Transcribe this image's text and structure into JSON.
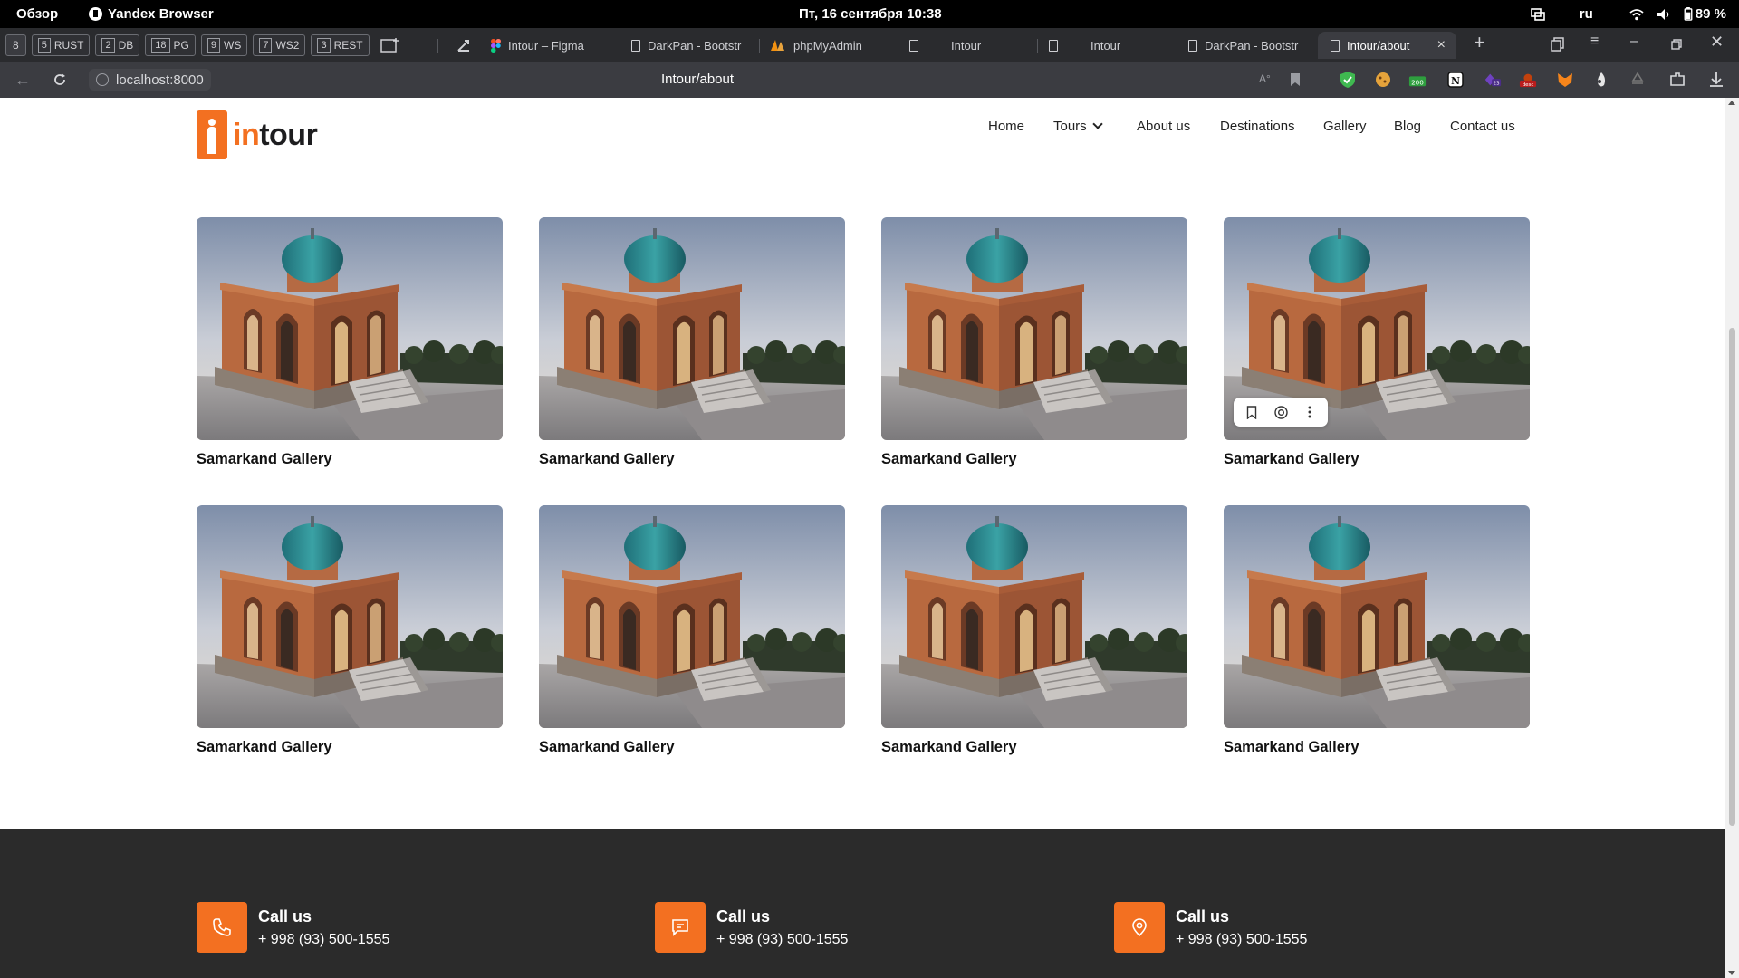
{
  "os_bar": {
    "overview": "Обзор",
    "app_name": "Yandex Browser",
    "clock": "Пт, 16 сентября  10:38",
    "lang": "ru",
    "battery": "89 %"
  },
  "workspaces": [
    {
      "num": "8",
      "label": ""
    },
    {
      "num": "5",
      "label": "RUST"
    },
    {
      "num": "2",
      "label": "DB"
    },
    {
      "num": "18",
      "label": "PG"
    },
    {
      "num": "9",
      "label": "WS"
    },
    {
      "num": "7",
      "label": "WS2"
    },
    {
      "num": "3",
      "label": "REST"
    }
  ],
  "tabs": [
    {
      "label": "Intour – Figma"
    },
    {
      "label": "DarkPan - Bootstr"
    },
    {
      "label": "phpMyAdmin"
    },
    {
      "label": "Intour"
    },
    {
      "label": "Intour"
    },
    {
      "label": "DarkPan - Bootstr"
    },
    {
      "label": "Intour/about"
    }
  ],
  "address_bar": {
    "url": "localhost:8000",
    "page_title": "Intour/about"
  },
  "site": {
    "logo_in": "in",
    "logo_tour": "tour",
    "nav": [
      "Home",
      "Tours",
      "About us",
      "Destinations",
      "Gallery",
      "Blog",
      "Contact us"
    ]
  },
  "gallery": [
    {
      "caption": "Samarkand Gallery"
    },
    {
      "caption": "Samarkand Gallery"
    },
    {
      "caption": "Samarkand Gallery"
    },
    {
      "caption": "Samarkand Gallery"
    },
    {
      "caption": "Samarkand Gallery"
    },
    {
      "caption": "Samarkand Gallery"
    },
    {
      "caption": "Samarkand Gallery"
    },
    {
      "caption": "Samarkand Gallery"
    }
  ],
  "footer": {
    "contacts": [
      {
        "title": "Call us",
        "value": "+ 998 (93) 500-1555",
        "icon": "phone-icon"
      },
      {
        "title": "Call us",
        "value": "+ 998 (93) 500-1555",
        "icon": "message-icon"
      },
      {
        "title": "Call us",
        "value": "+ 998 (93) 500-1555",
        "icon": "location-pin-icon"
      }
    ]
  },
  "colors": {
    "brand_orange": "#f37021",
    "footer_bg": "#2b2b2b",
    "browser_chrome": "#2a2b2e"
  }
}
